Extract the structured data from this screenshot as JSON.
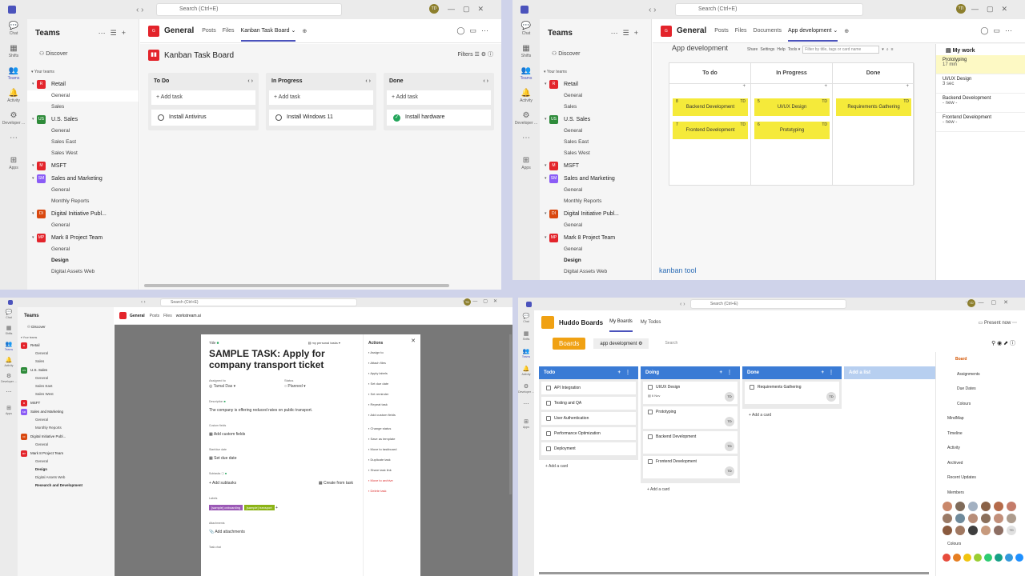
{
  "common": {
    "search": "Search (Ctrl+E)",
    "teams_label": "Teams",
    "discover": "Discover",
    "your_teams": "Your teams",
    "avatar": "TD"
  },
  "rail": [
    {
      "label": "Chat",
      "glyph": "💬"
    },
    {
      "label": "Shifts",
      "glyph": "▦"
    },
    {
      "label": "Teams",
      "glyph": "👥"
    },
    {
      "label": "Activity",
      "glyph": "🔔"
    },
    {
      "label": "Developer ...",
      "glyph": "⚙"
    },
    {
      "label": "",
      "glyph": "⋯"
    },
    {
      "label": "Apps",
      "glyph": "⊞"
    }
  ],
  "teams": [
    {
      "name": "Retail",
      "color": "#e3242b",
      "init": "R",
      "channels": [
        "General",
        "Sales"
      ]
    },
    {
      "name": "U.S. Sales",
      "color": "#2e8b3a",
      "init": "US",
      "channels": [
        "General",
        "Sales East",
        "Sales West"
      ]
    },
    {
      "name": "MSFT",
      "color": "#e3242b",
      "init": "M",
      "channels": []
    },
    {
      "name": "Sales and Marketing",
      "color": "#8b5cf6",
      "init": "SM",
      "channels": [
        "General",
        "Monthly Reports"
      ]
    },
    {
      "name": "Digital Initiative Publ...",
      "color": "#d9480f",
      "init": "DI",
      "channels": [
        "General"
      ]
    },
    {
      "name": "Mark 8 Project Team",
      "color": "#e3242b",
      "init": "MP",
      "channels": [
        "General",
        "Design",
        "Digital Assets Web"
      ]
    }
  ],
  "q1": {
    "channel": "General",
    "tabs": [
      "Posts",
      "Files",
      "Kanban Task Board"
    ],
    "board_title": "Kanban Task Board",
    "filters": "Filters",
    "columns": [
      {
        "title": "To Do",
        "add": "+ Add task",
        "cards": [
          {
            "text": "Install Antivirus",
            "done": false
          }
        ]
      },
      {
        "title": "In Progress",
        "add": "+ Add task",
        "cards": [
          {
            "text": "Install Windows 11",
            "done": false
          }
        ]
      },
      {
        "title": "Done",
        "add": "+ Add task",
        "cards": [
          {
            "text": "Install hardware",
            "done": true
          }
        ]
      }
    ]
  },
  "q2": {
    "channel": "General",
    "tabs": [
      "Posts",
      "Files",
      "Documents",
      "App development"
    ],
    "subtitle": "App development",
    "tools": [
      "Share",
      "Settings",
      "Help",
      "Tools ▾"
    ],
    "filter_placeholder": "Filter by title, tags or card name",
    "columns": [
      "To do",
      "In Progress",
      "Done"
    ],
    "cards": [
      {
        "col": 0,
        "row": 0,
        "text": "Backend Development",
        "num": "8"
      },
      {
        "col": 0,
        "row": 1,
        "text": "Frontend Development",
        "num": "7"
      },
      {
        "col": 1,
        "row": 0,
        "text": "UI/UX Design",
        "num": "5"
      },
      {
        "col": 1,
        "row": 1,
        "text": "Prototyping",
        "num": "6"
      },
      {
        "col": 2,
        "row": 0,
        "text": "Requirements Gathering",
        "num": ""
      }
    ],
    "my_work": {
      "title": "My work",
      "items": [
        {
          "name": "Prototyping",
          "sub": "17 min",
          "hl": true
        },
        {
          "name": "UI/UX Design",
          "sub": "3 sec",
          "hl": false
        },
        {
          "name": "Backend Development",
          "sub": "- new -",
          "hl": false
        },
        {
          "name": "Frontend Development",
          "sub": "- new -",
          "hl": false
        }
      ]
    },
    "logo": "kanban tool"
  },
  "q3": {
    "channel": "General",
    "tabs": [
      "Posts",
      "Files",
      "workstream.ai"
    ],
    "field_label": "Title",
    "list": "my personal tasks",
    "title": "SAMPLE TASK: Apply for company transport ticket",
    "assigned_label": "Assigned to",
    "assignee": "Tamal Das",
    "status_label": "Status",
    "status": "Planned",
    "desc_label": "Description",
    "description": "The company is offering reduced rates on public transport.",
    "custom_label": "Custom fields",
    "add_custom": "Add custom fields",
    "date_label": "Start/due date",
    "set_due": "Set due date",
    "subtasks_label": "Subtasks",
    "add_subtasks": "Add subtasks",
    "create_template": "Create from task",
    "labels_label": "Labels",
    "label1": "[sample] onboarding",
    "label2": "[sample] transport",
    "attach_label": "Attachments",
    "add_attach": "Add attachments",
    "task_chat": "Task chat",
    "actions_title": "Actions",
    "actions": [
      "Assign to",
      "Attach files",
      "Apply labels",
      "Set due date",
      "Set reminder",
      "Repeat task",
      "Add custom fields",
      "",
      "Change status",
      "Save as template",
      "Move to taskboard",
      "Duplicate task",
      "Share task link",
      "Move to archive",
      "Delete task"
    ]
  },
  "q4": {
    "app": "Huddo Boards",
    "tabs": [
      "My Boards",
      "My Todos"
    ],
    "present": "Present now",
    "boards_btn": "Boards",
    "board_name": "app development",
    "search": "Search",
    "columns": [
      {
        "title": "Todo",
        "cards": [
          "API Integration",
          "Testing and QA",
          "User Authentication",
          "Performance Optimization",
          "Deployment"
        ],
        "tall": false
      },
      {
        "title": "Doing",
        "cards": [
          "UI/UX Design",
          "Prototyping",
          "Backend Development",
          "Frontend Development"
        ],
        "tall": true,
        "due": "6 Nov"
      },
      {
        "title": "Done",
        "cards": [
          "Requirements Gathering"
        ],
        "tall": true
      },
      {
        "title": "Add a list",
        "cards": [],
        "tall": false
      }
    ],
    "add_card": "+ Add a card",
    "panel": [
      {
        "t": "Board",
        "cls": "top"
      },
      {
        "t": "Assignments",
        "cls": "ind"
      },
      {
        "t": "Due Dates",
        "cls": "ind"
      },
      {
        "t": "Colours",
        "cls": "ind"
      },
      {
        "t": "MindMap",
        "cls": ""
      },
      {
        "t": "Timeline",
        "cls": ""
      },
      {
        "t": "Activity",
        "cls": ""
      },
      {
        "t": "Archived",
        "cls": ""
      },
      {
        "t": "Recent Updates",
        "cls": ""
      },
      {
        "t": "Members",
        "cls": ""
      }
    ],
    "colours_label": "Colours",
    "avatar_colors": [
      "#c9876a",
      "#7f6b5a",
      "#a3b1c2",
      "#8a6247",
      "#b56b4a",
      "#c47c6a",
      "#9a7a66",
      "#6f8a9b",
      "#b88d78",
      "#8a6f5a",
      "#c28f7a",
      "#ad9b8c",
      "#8a5a3e",
      "#a07861",
      "#3e3e3e",
      "#c79a7d",
      "#8d6e63",
      "#e0e0e0"
    ],
    "colour_swatches": [
      "#e74c3c",
      "#e67e22",
      "#f1c40f",
      "#9acd32",
      "#2ecc71",
      "#16a085",
      "#3498db",
      "#1e90ff"
    ]
  }
}
